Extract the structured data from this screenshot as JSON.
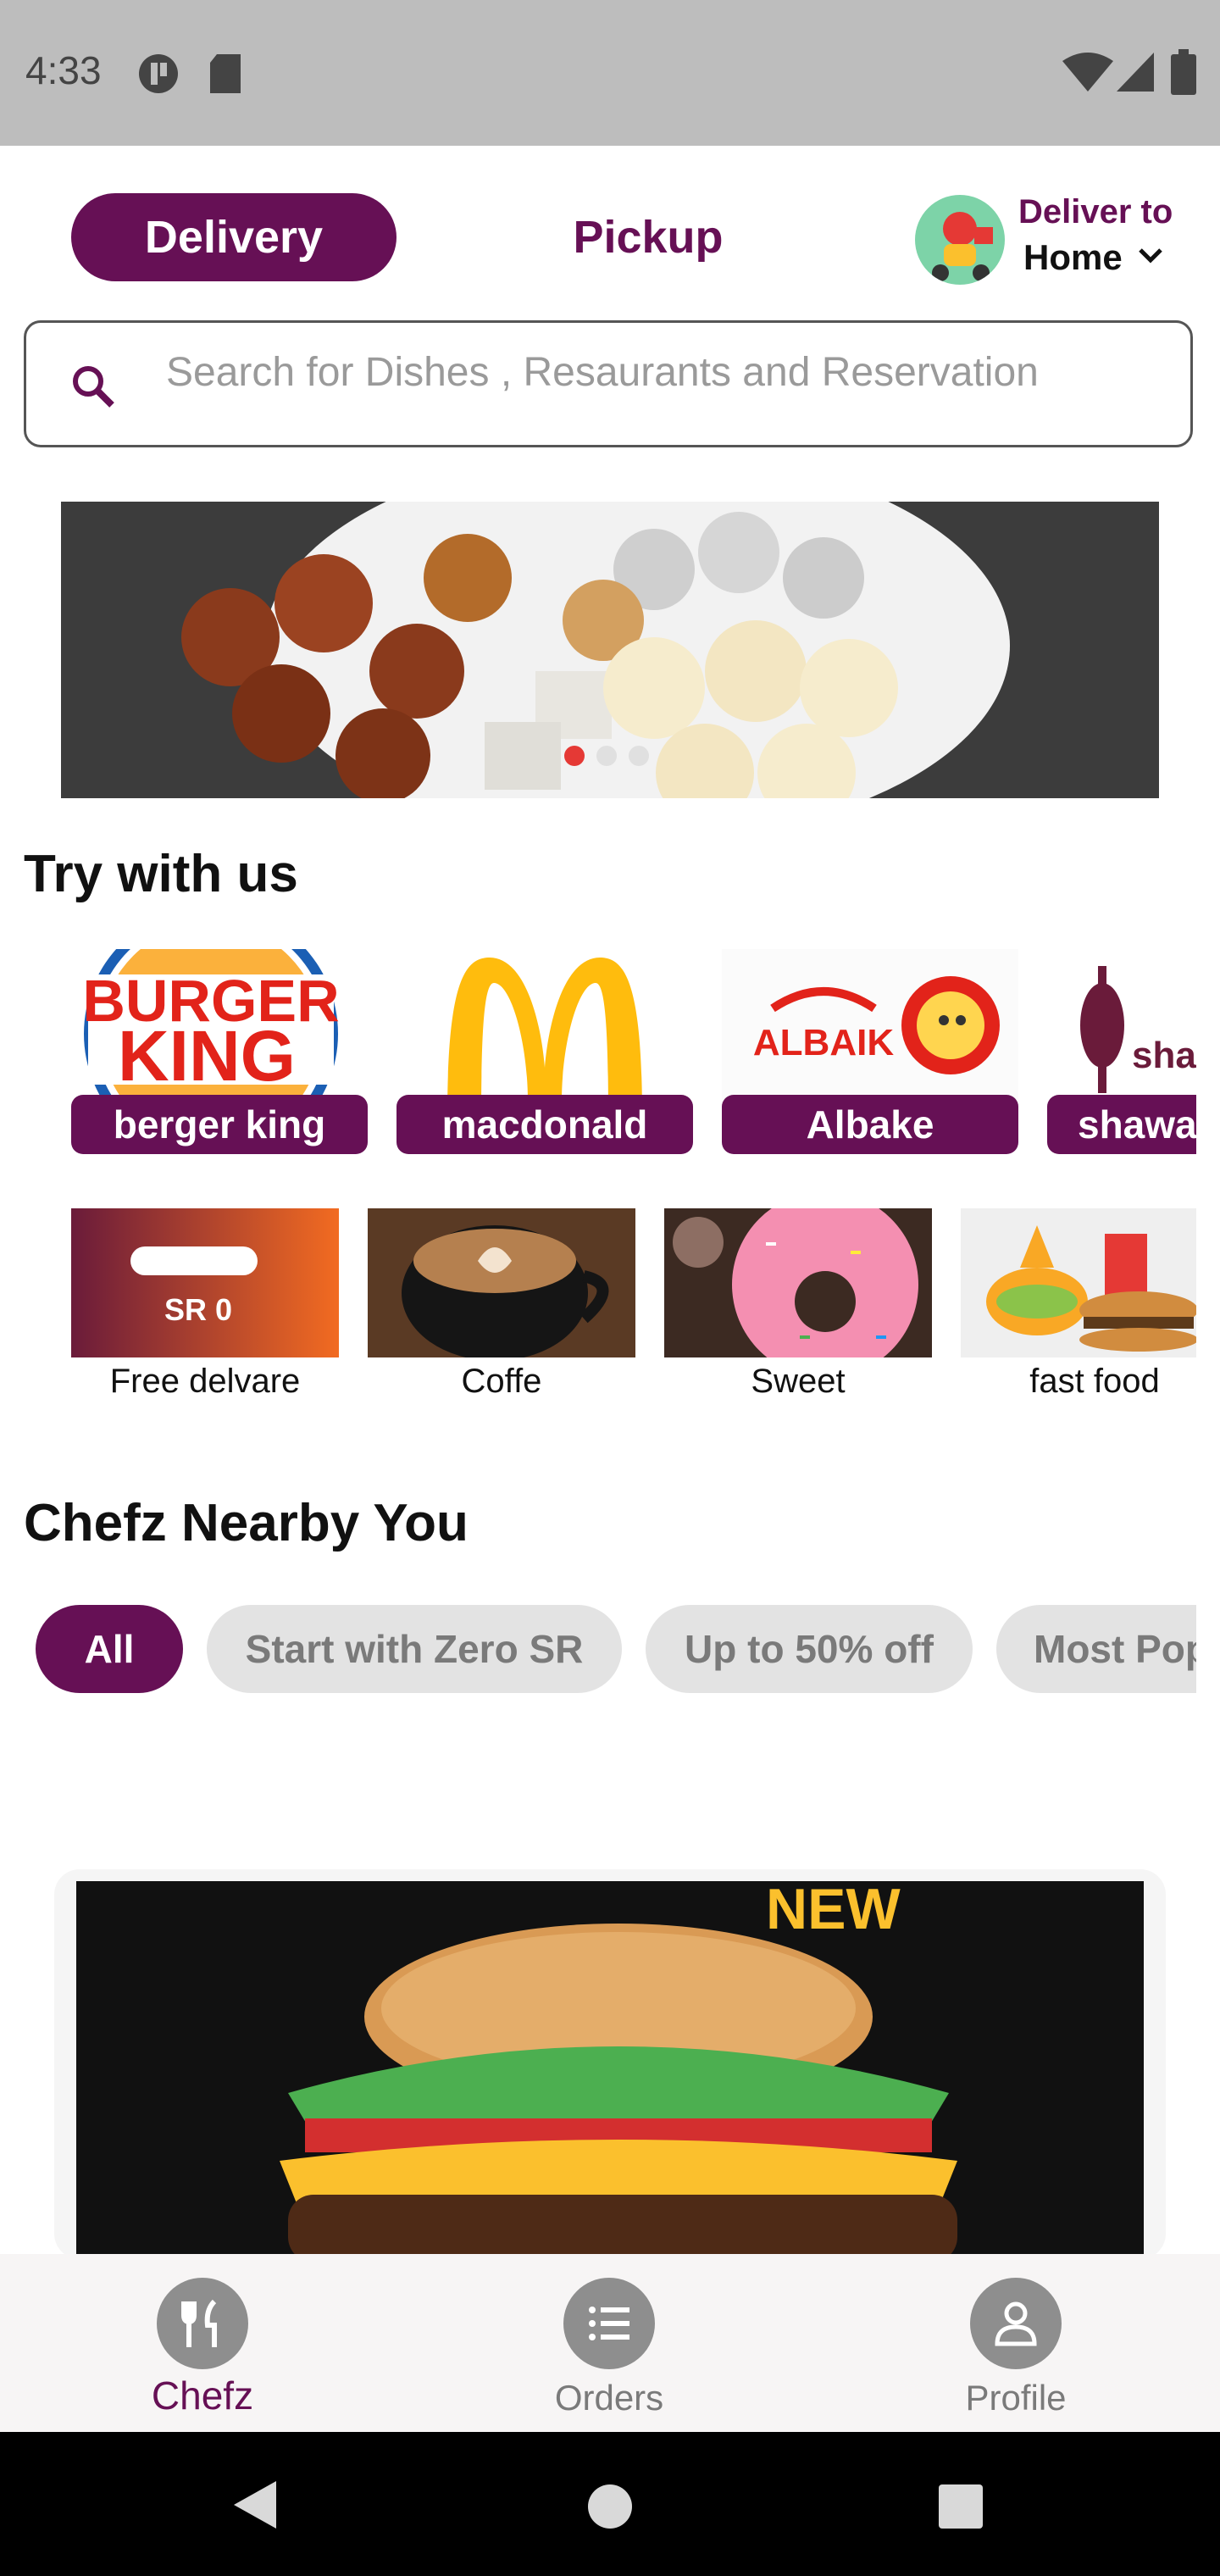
{
  "status_bar": {
    "time": "4:33"
  },
  "top_bar": {
    "delivery_label": "Delivery",
    "pickup_label": "Pickup",
    "deliver_to_label": "Deliver to",
    "location": "Home"
  },
  "search": {
    "placeholder": "Search for Dishes , Resaurants and Reservation"
  },
  "sections": {
    "try_title": "Try with us",
    "nearby_title": "Chefz Nearby You"
  },
  "brands": [
    {
      "label": "berger king",
      "logo": "burger-king-logo"
    },
    {
      "label": "macdonald",
      "logo": "mcdonalds-logo"
    },
    {
      "label": "Albake",
      "logo": "albaik-logo"
    },
    {
      "label": "shawa",
      "logo": "shawarma-logo"
    }
  ],
  "categories": [
    {
      "label": "Free delvare"
    },
    {
      "label": "Coffe"
    },
    {
      "label": "Sweet"
    },
    {
      "label": "fast food"
    }
  ],
  "filters": [
    {
      "label": "All",
      "active": true
    },
    {
      "label": "Start with Zero SR",
      "active": false
    },
    {
      "label": "Up to 50% off",
      "active": false
    },
    {
      "label": "Most Pop",
      "active": false
    }
  ],
  "restaurant_banner": {
    "badge": "NEW"
  },
  "bottom_nav": {
    "chefz": "Chefz",
    "orders": "Orders",
    "profile": "Profile"
  },
  "colors": {
    "brand": "#661055",
    "chip_idle": "#e3e3e3"
  }
}
